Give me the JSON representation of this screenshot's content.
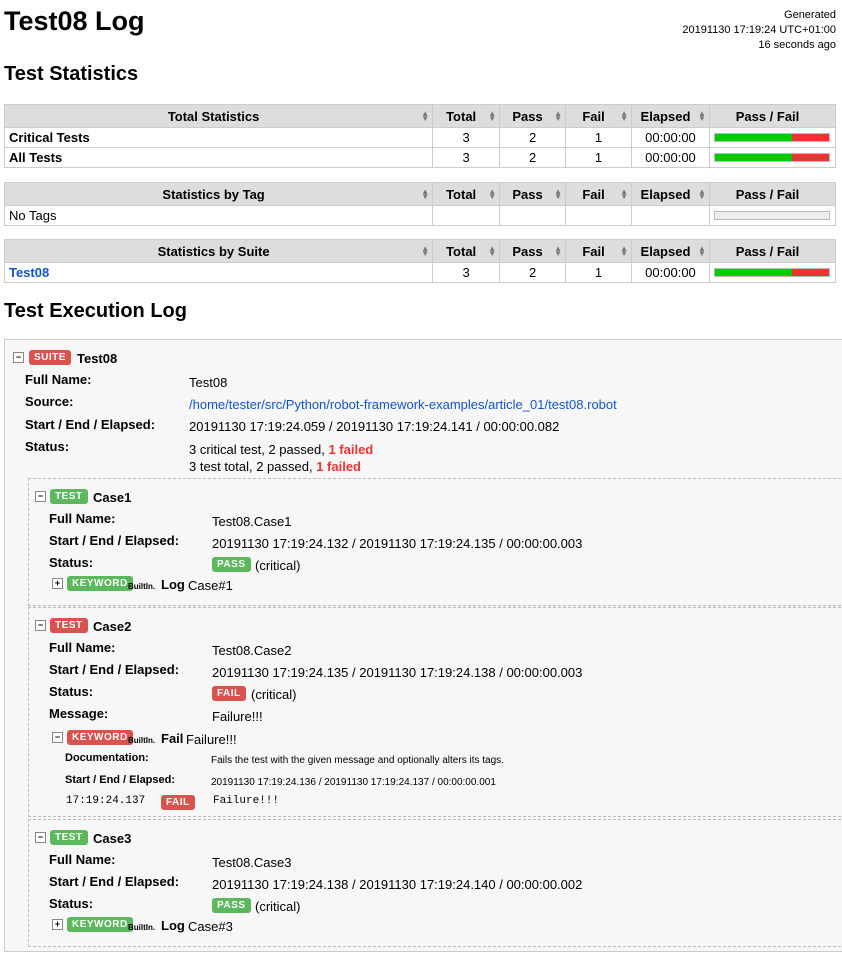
{
  "header": {
    "title": "Test08 Log",
    "generated_label": "Generated",
    "generated_time": "20191130 17:19:24 UTC+01:00",
    "generated_ago": "16 seconds ago"
  },
  "sections": {
    "statistics": "Test Statistics",
    "log": "Test Execution Log"
  },
  "columns": {
    "total": "Total",
    "pass": "Pass",
    "fail": "Fail",
    "elapsed": "Elapsed",
    "passfail": "Pass / Fail"
  },
  "total_stats": {
    "header": "Total Statistics",
    "rows": [
      {
        "name": "Critical Tests",
        "total": "3",
        "pass": "2",
        "fail": "1",
        "elapsed": "00:00:00",
        "pass_ratio": 0.667
      },
      {
        "name": "All Tests",
        "total": "3",
        "pass": "2",
        "fail": "1",
        "elapsed": "00:00:00",
        "pass_ratio": 0.667
      }
    ]
  },
  "tag_stats": {
    "header": "Statistics by Tag",
    "rows": [
      {
        "name": "No Tags"
      }
    ]
  },
  "suite_stats": {
    "header": "Statistics by Suite",
    "rows": [
      {
        "name": "Test08",
        "total": "3",
        "pass": "2",
        "fail": "1",
        "elapsed": "00:00:00",
        "pass_ratio": 0.667
      }
    ]
  },
  "labels": {
    "full_name": "Full Name:",
    "source": "Source:",
    "start_end": "Start / End / Elapsed:",
    "status": "Status:",
    "message": "Message:",
    "documentation": "Documentation:",
    "suite": "SUITE",
    "test": "TEST",
    "keyword": "KEYWORD",
    "pass": "PASS",
    "fail": "FAIL",
    "critical": "(critical)",
    "builtin": "BuiltIn."
  },
  "suite": {
    "name": "Test08",
    "full_name": "Test08",
    "source": "/home/tester/src/Python/robot-framework-examples/article_01/test08.robot",
    "times": "20191130 17:19:24.059 / 20191130 17:19:24.141 / 00:00:00.082",
    "status_line1": "3 critical test, 2 passed, ",
    "status_line2": "3 test total, 2 passed, ",
    "failed_text": "1 failed"
  },
  "tests": [
    {
      "name": "Case1",
      "full_name": "Test08.Case1",
      "times": "20191130 17:19:24.132 / 20191130 17:19:24.135 / 00:00:00.003",
      "kw_name": "Log",
      "kw_args": "Case#1"
    },
    {
      "name": "Case2",
      "full_name": "Test08.Case2",
      "times": "20191130 17:19:24.135 / 20191130 17:19:24.138 / 00:00:00.003",
      "message": "Failure!!!",
      "kw_name": "Fail",
      "kw_args": "Failure!!!",
      "kw_doc": "Fails the test with the given message and optionally alters its tags.",
      "kw_times": "20191130 17:19:24.136 / 20191130 17:19:24.137 / 00:00:00.001",
      "msg_time": "17:19:24.137",
      "msg_text": "Failure!!!"
    },
    {
      "name": "Case3",
      "full_name": "Test08.Case3",
      "times": "20191130 17:19:24.138 / 20191130 17:19:24.140 / 00:00:00.002",
      "kw_name": "Log",
      "kw_args": "Case#3"
    }
  ],
  "colors": {
    "pass": "#00cc00",
    "fail": "#ee3333",
    "link": "#1155cc"
  }
}
